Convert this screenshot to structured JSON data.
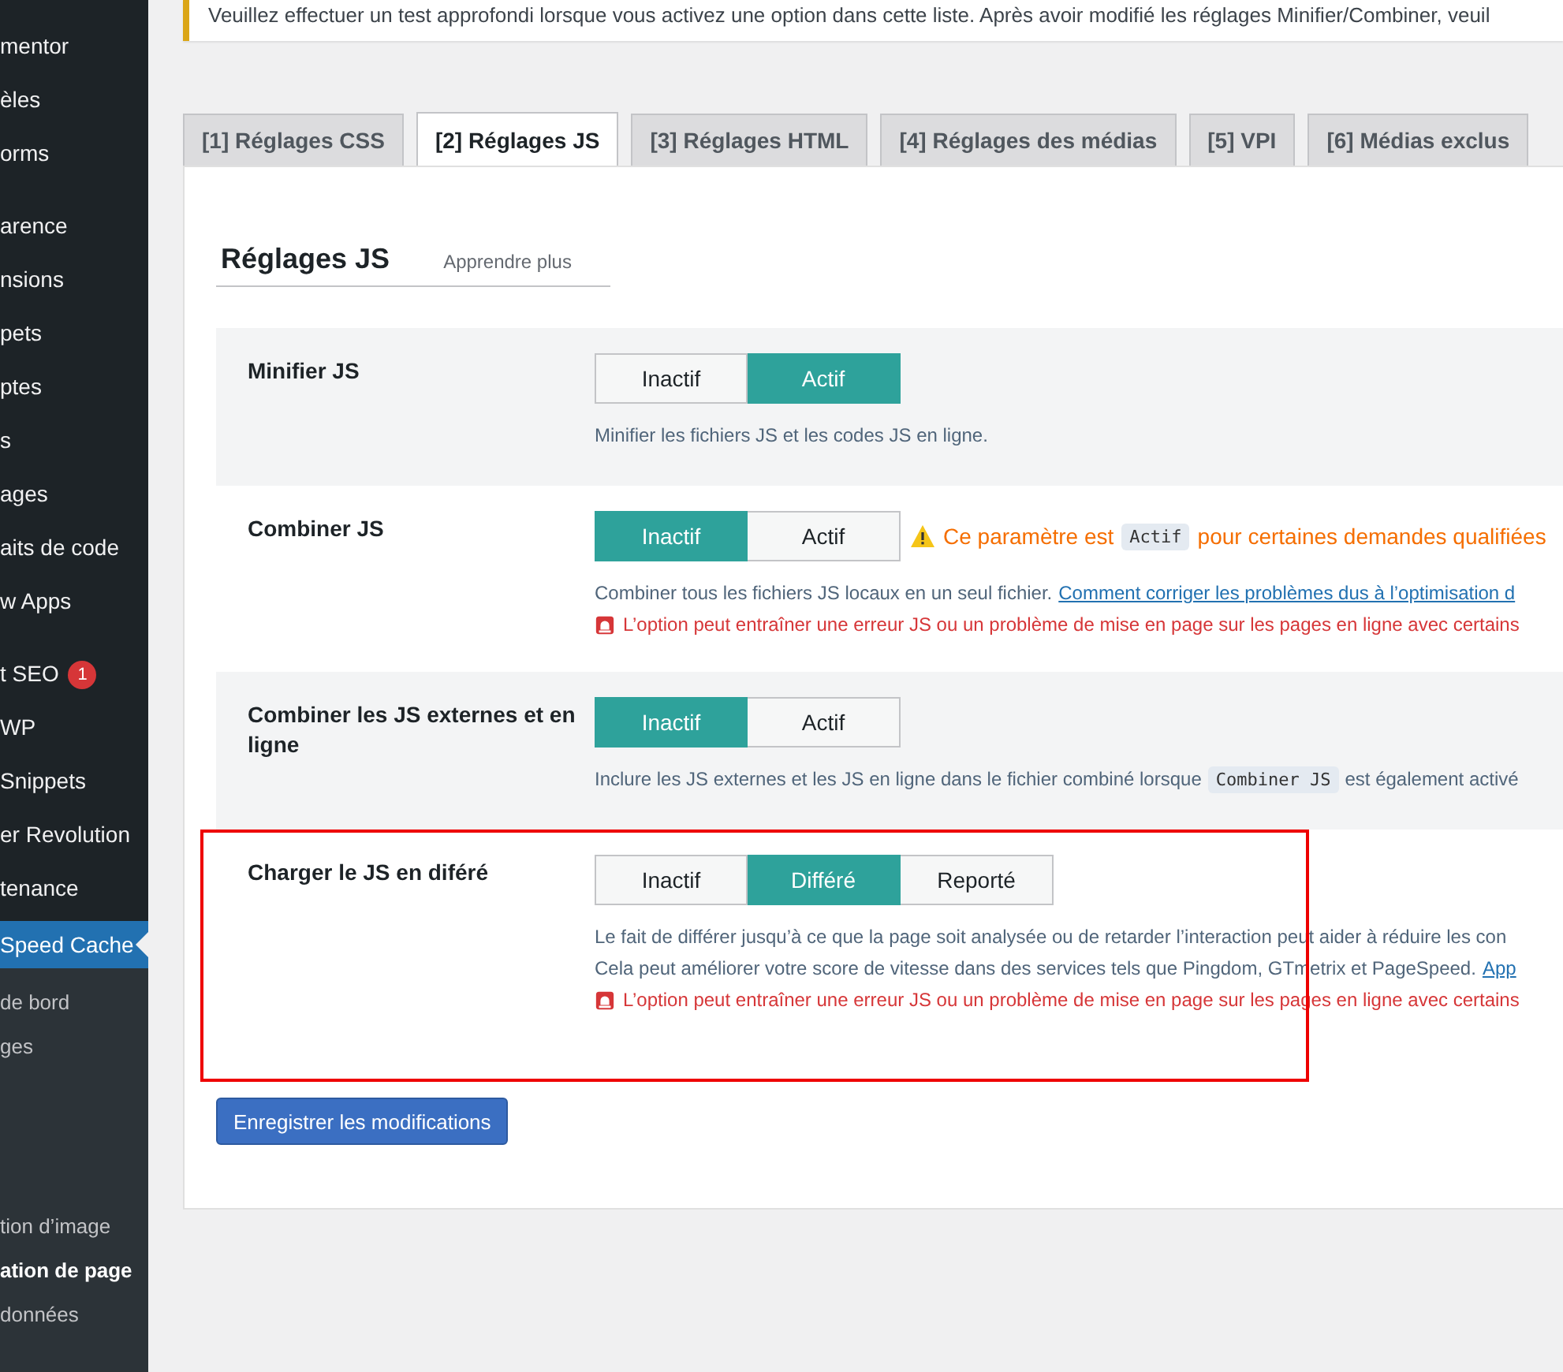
{
  "sidebar": {
    "groups": [
      [
        {
          "label": "mentor",
          "selected": false
        },
        {
          "label": "èles",
          "selected": false
        },
        {
          "label": "orms",
          "selected": false
        }
      ],
      [
        {
          "label": "arence",
          "selected": false
        },
        {
          "label": "nsions",
          "selected": false
        },
        {
          "label": "pets",
          "selected": false
        },
        {
          "label": "ptes",
          "selected": false
        },
        {
          "label": "s",
          "selected": false
        },
        {
          "label": "ages",
          "selected": false
        },
        {
          "label": "aits de code",
          "selected": false
        },
        {
          "label": "w Apps",
          "selected": false
        }
      ],
      [
        {
          "label": "t SEO",
          "selected": false,
          "badge": "1"
        },
        {
          "label": "WP",
          "selected": false
        },
        {
          "label": "Snippets",
          "selected": false
        },
        {
          "label": "er Revolution",
          "selected": false
        },
        {
          "label": "tenance",
          "selected": false
        },
        {
          "label": "Speed Cache",
          "selected": true
        }
      ]
    ],
    "submenu": [
      [
        {
          "label": "de bord",
          "selected": false
        },
        {
          "label": "ges",
          "selected": false
        }
      ],
      [
        {
          "label": "tion d’image",
          "selected": false
        },
        {
          "label": "ation de page",
          "selected": true
        },
        {
          "label": "données",
          "selected": false
        }
      ]
    ]
  },
  "notice": {
    "text": "Veuillez effectuer un test approfondi lorsque vous activez une option dans cette liste. Après avoir modifié les réglages Minifier/Combiner, veuil"
  },
  "tabs": [
    {
      "label": "[1] Réglages CSS",
      "selected": false
    },
    {
      "label": "[2] Réglages JS",
      "selected": true
    },
    {
      "label": "[3] Réglages HTML",
      "selected": false
    },
    {
      "label": "[4] Réglages des médias",
      "selected": false
    },
    {
      "label": "[5] VPI",
      "selected": false
    },
    {
      "label": "[6] Médias exclus",
      "selected": false
    }
  ],
  "section": {
    "title": "Réglages JS",
    "link": "Apprendre plus"
  },
  "rows": [
    {
      "label": "Minifier JS",
      "highlighted": false,
      "options": [
        {
          "label": "Inactif",
          "selected": false
        },
        {
          "label": "Actif",
          "selected": true
        }
      ],
      "lines": [
        [
          {
            "kind": "text",
            "text": "Minifier les fichiers JS et les codes JS en ligne."
          }
        ]
      ],
      "errors": []
    },
    {
      "label": "Combiner JS",
      "highlighted": false,
      "options": [
        {
          "label": "Inactif",
          "selected": true
        },
        {
          "label": "Actif",
          "selected": false
        }
      ],
      "warning": [
        {
          "kind": "text",
          "text": "Ce paramètre est"
        },
        {
          "kind": "code",
          "text": "Actif"
        },
        {
          "kind": "text",
          "text": "pour certaines demandes qualifiées"
        }
      ],
      "lines": [
        [
          {
            "kind": "text",
            "text": "Combiner tous les fichiers JS locaux en un seul fichier."
          },
          {
            "kind": "link",
            "text": "Comment corriger les problèmes dus à l’optimisation d"
          }
        ]
      ],
      "errors": [
        "L’option peut entraîner une erreur JS ou un problème de mise en page sur les pages en ligne avec certains"
      ]
    },
    {
      "label": "Combiner les JS externes et en ligne",
      "highlighted": false,
      "options": [
        {
          "label": "Inactif",
          "selected": true
        },
        {
          "label": "Actif",
          "selected": false
        }
      ],
      "lines": [
        [
          {
            "kind": "text",
            "text": "Inclure les JS externes et les JS en ligne dans le fichier combiné lorsque"
          },
          {
            "kind": "code",
            "text": "Combiner JS"
          },
          {
            "kind": "text",
            "text": "est également activé"
          }
        ]
      ],
      "errors": []
    },
    {
      "label": "Charger le JS en diféré",
      "highlighted": true,
      "options": [
        {
          "label": "Inactif",
          "selected": false
        },
        {
          "label": "Différé",
          "selected": true
        },
        {
          "label": "Reporté",
          "selected": false
        }
      ],
      "lines": [
        [
          {
            "kind": "text",
            "text": "Le fait de différer jusqu’à ce que la page soit analysée ou de retarder l’interaction peut aider à réduire les con"
          }
        ],
        [
          {
            "kind": "text",
            "text": "Cela peut améliorer votre score de vitesse dans des services tels que Pingdom, GTmetrix et PageSpeed."
          },
          {
            "kind": "link",
            "text": "App"
          }
        ]
      ],
      "errors": [
        "L’option peut entraîner une erreur JS ou un problème de mise en page sur les pages en ligne avec certains"
      ]
    }
  ],
  "save_button": "Enregistrer les modifications"
}
